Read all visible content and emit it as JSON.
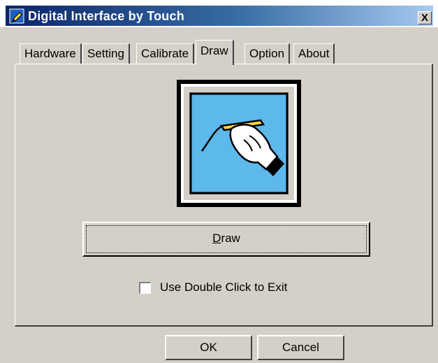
{
  "window": {
    "title": "Digital Interface by Touch",
    "app_icon": "pen-app-icon",
    "close_label": "X"
  },
  "tabs": [
    {
      "label": "Hardware",
      "active": false
    },
    {
      "label": "Setting",
      "active": false
    },
    {
      "label": "Calibrate",
      "active": false
    },
    {
      "label": "Draw",
      "active": true
    },
    {
      "label": "Option",
      "active": false
    },
    {
      "label": "About",
      "active": false
    }
  ],
  "draw_panel": {
    "illustration_icon": "hand-with-pen-icon",
    "illustration_bg": "#5db8ec",
    "draw_button": {
      "mnemonic": "D",
      "rest": "raw"
    },
    "double_click_checkbox": {
      "label": "Use Double Click to Exit",
      "checked": false
    }
  },
  "footer": {
    "ok_label": "OK",
    "cancel_label": "Cancel"
  },
  "colors": {
    "titlebar_start": "#0a246a",
    "titlebar_end": "#a6caf0",
    "face": "#d4d0c8"
  }
}
